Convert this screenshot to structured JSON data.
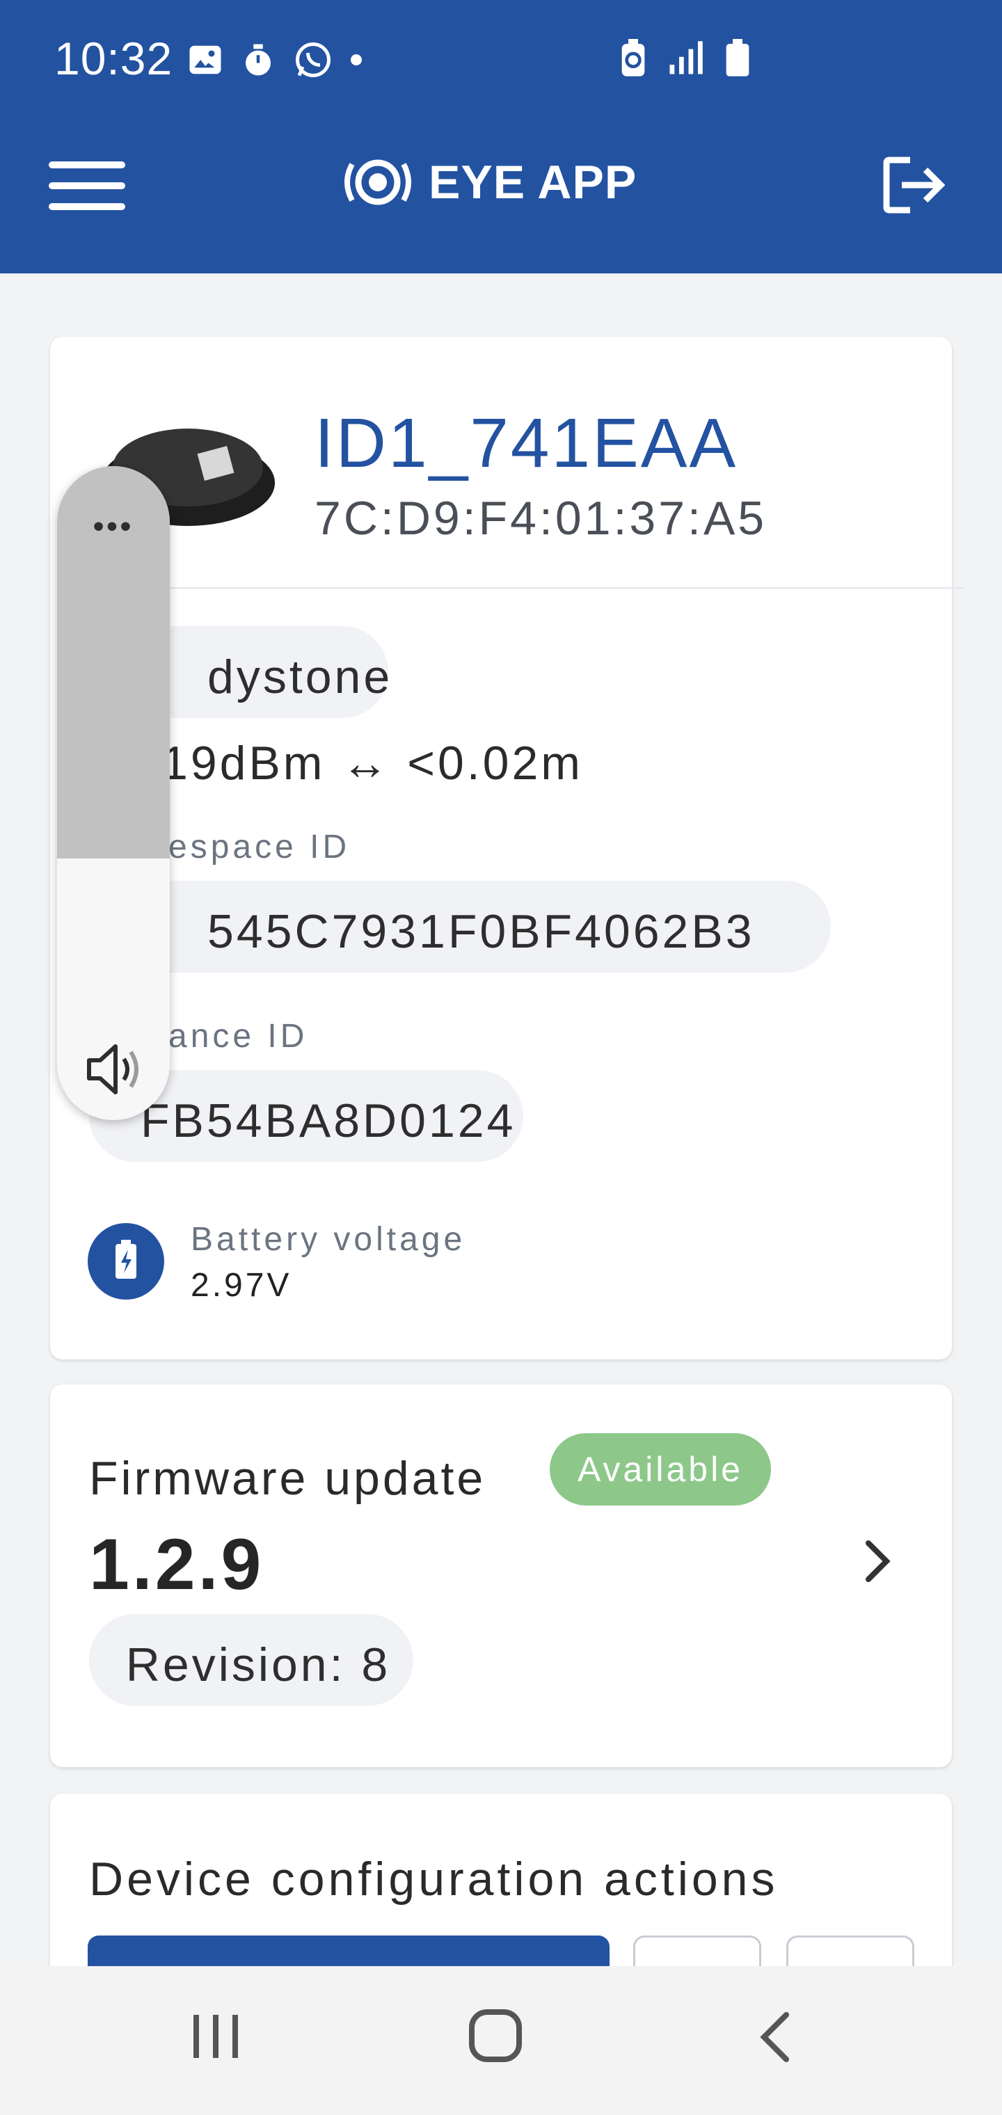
{
  "status_bar": {
    "time": "10:32",
    "left_icons": [
      "image-icon",
      "timer-icon",
      "whatsapp-icon",
      "dot-icon"
    ],
    "right_icons": [
      "battery-saver-icon",
      "signal-icon",
      "battery-icon"
    ]
  },
  "app_bar": {
    "brand": "EYE APP",
    "menu_icon": "hamburger-icon",
    "logout_icon": "logout-icon"
  },
  "device": {
    "name": "ID1_741EAA",
    "mac": "7C:D9:F4:01:37:A5",
    "type_chip": "dystone",
    "tx_power": "19dBm ↔ <0.02m",
    "namespace_label": "espace ID",
    "namespace_value": "545C7931F0BF4062B3",
    "instance_label": "ance ID",
    "instance_value": "FB54BA8D0124",
    "battery_label": "Battery voltage",
    "battery_value": "2.97V"
  },
  "firmware": {
    "title": "Firmware update",
    "badge": "Available",
    "version": "1.2.9",
    "revision": "Revision: 8"
  },
  "config": {
    "title": "Device configuration actions"
  },
  "volume_overlay": {
    "menu_dots": "•••",
    "level_fraction": 0.6
  },
  "colors": {
    "brand_blue": "#2352a1",
    "badge_green": "#8dc88a",
    "background": "#f2f3f5"
  }
}
